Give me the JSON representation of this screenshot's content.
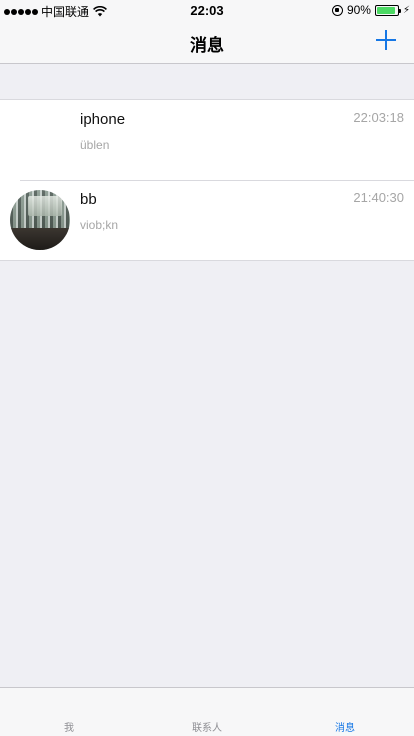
{
  "status_bar": {
    "carrier": "中国联通",
    "time": "22:03",
    "battery_percent": "90%",
    "battery_level": 0.9
  },
  "nav": {
    "title": "消息",
    "add_icon": "plus-icon"
  },
  "messages": [
    {
      "name": "iphone",
      "preview": "üblen",
      "time": "22:03:18",
      "has_avatar": false
    },
    {
      "name": "bb",
      "preview": "viob;kn",
      "time": "21:40:30",
      "has_avatar": true
    }
  ],
  "tabs": [
    {
      "label": "我",
      "active": false
    },
    {
      "label": "联系人",
      "active": false
    },
    {
      "label": "消息",
      "active": true
    }
  ],
  "colors": {
    "accent": "#1677e5",
    "background": "#efeff4",
    "secondary_text": "#a6a6a6",
    "battery": "#4cd964"
  }
}
